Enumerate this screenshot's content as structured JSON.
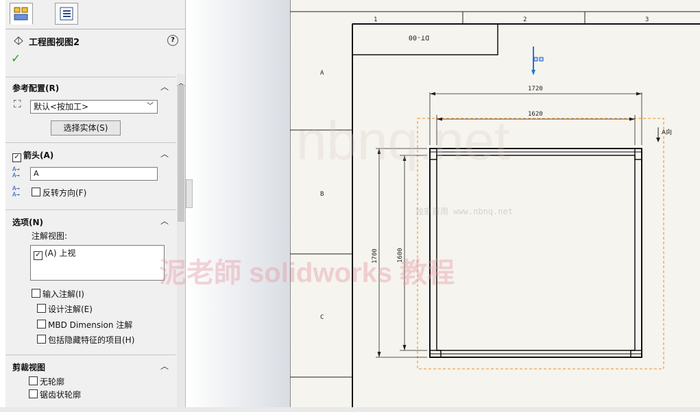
{
  "panel": {
    "title": "工程图视图2",
    "help": "?",
    "ok_mark": "✓",
    "ref_config": {
      "header": "参考配置(R)",
      "selected": "默认<按加工>",
      "button": "选择实体(S)"
    },
    "arrow": {
      "header": "箭头(A)",
      "label_value": "A",
      "reverse": "反转方向(F)"
    },
    "options": {
      "header": "选项(N)",
      "annot_view_label": "注解视图:",
      "annot_item": "(A) 上视",
      "import_annot": "输入注解(I)",
      "design_annot": "设计注解(E)",
      "mbd_annot": "MBD Dimension 注解",
      "hidden_items": "包括隐藏特征的项目(H)"
    },
    "crop": {
      "header": "剪裁视图",
      "no_outline": "无轮廓",
      "jagged": "锯齿状轮廓"
    }
  },
  "drawing": {
    "col_labels": [
      "1",
      "2",
      "3"
    ],
    "row_labels": [
      "A",
      "B",
      "C"
    ],
    "doc_code": "DT-00",
    "dims": {
      "outer_width": "1720",
      "inner_width": "1620",
      "outer_height": "1700",
      "inner_height": "1600"
    },
    "section_label": "A向"
  },
  "watermarks": {
    "brand": "nbnq.net",
    "small": "独家首用 www.nbnq.net",
    "cn": "泥老師 solidworks 教程"
  },
  "icons": [
    "property-tab-icon",
    "config-tab-icon",
    "drawing-view-icon",
    "help-icon",
    "ok-icon",
    "config-icon",
    "arrow-label-icon",
    "reverse-direction-icon",
    "collapse-chevron-icon",
    "dropdown-arrow-icon"
  ],
  "colors": {
    "panel_bg": "#f0f0f0",
    "sheet_bg": "#f5f4ee",
    "ok_green": "#2aa02a",
    "crop_orange": "#f28a1e",
    "arrow_blue": "#1e78d8"
  }
}
